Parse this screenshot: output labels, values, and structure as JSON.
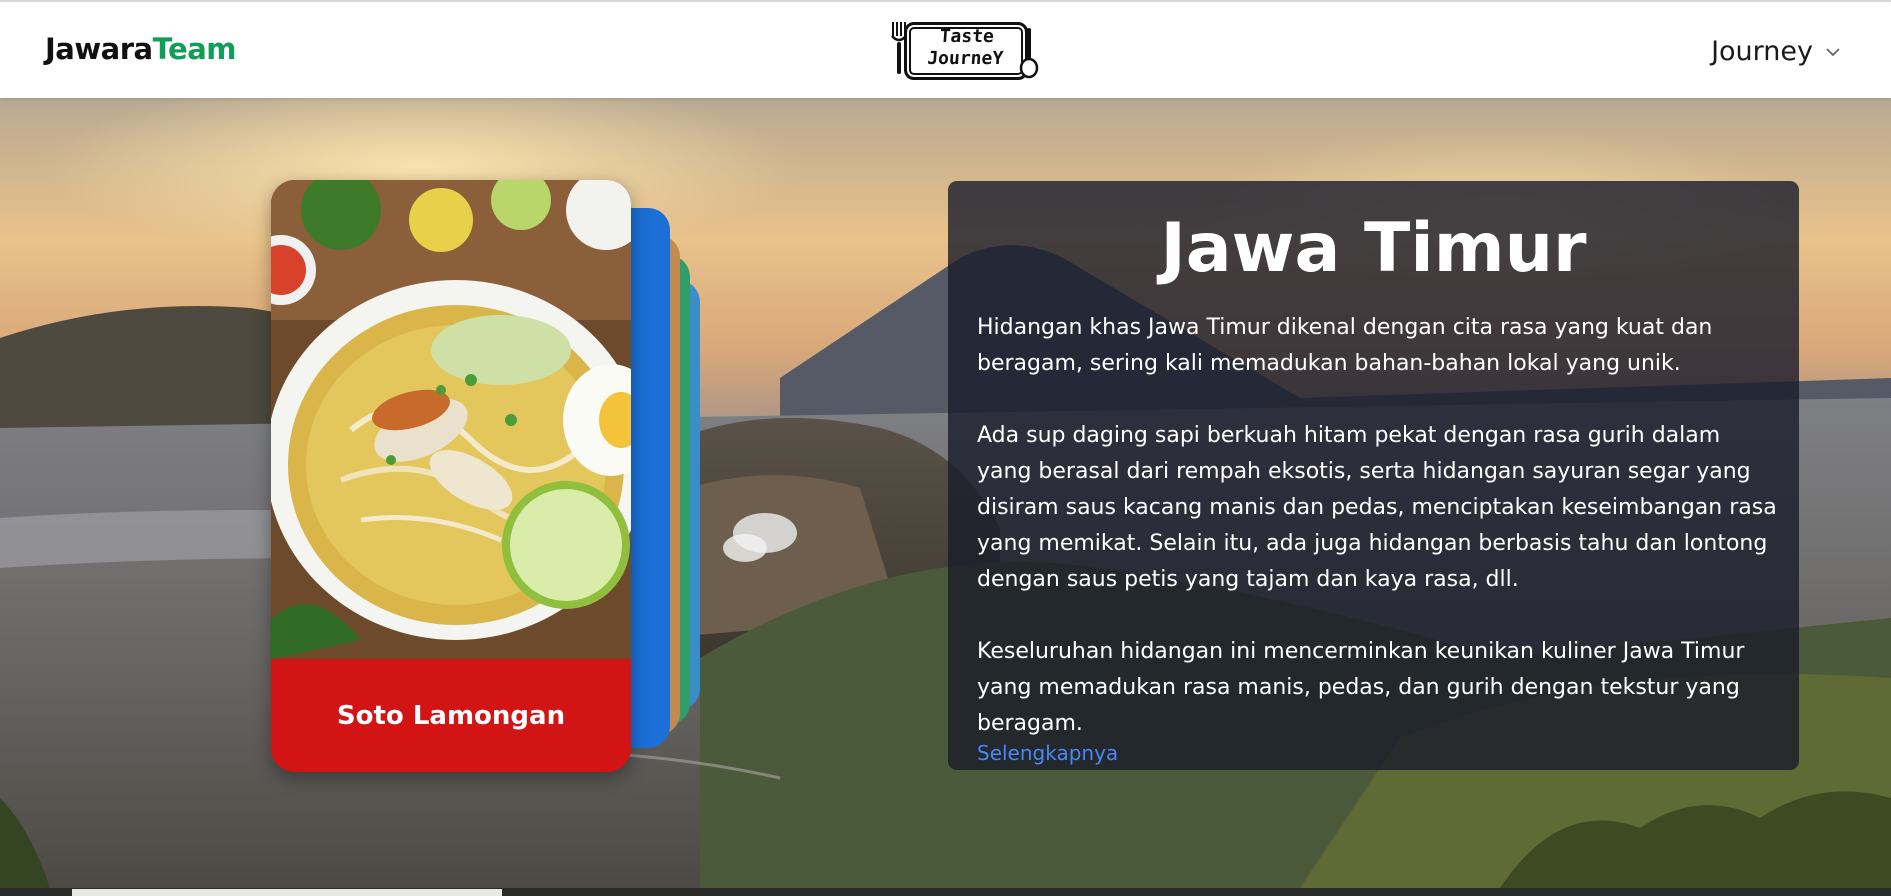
{
  "header": {
    "brand_part1": "Jawara",
    "brand_part2": "Team",
    "logo_line1": "Taste",
    "logo_line2": "JourneY",
    "nav_label": "Journey",
    "nav_icon": "chevron-down-icon"
  },
  "card": {
    "title": "Soto Lamongan",
    "caption_color": "#d21414"
  },
  "info": {
    "title": "Jawa Timur",
    "paragraphs": [
      "Hidangan khas Jawa Timur dikenal dengan cita rasa yang kuat dan beragam, sering kali memadukan bahan-bahan lokal yang unik.",
      "Ada sup daging sapi berkuah hitam pekat dengan rasa gurih dalam yang berasal dari rempah eksotis, serta hidangan sayuran segar yang disiram saus kacang manis dan pedas, menciptakan keseimbangan rasa yang memikat. Selain itu, ada juga hidangan berbasis tahu dan lontong dengan saus petis yang tajam dan kaya rasa, dll.",
      "Keseluruhan hidangan ini mencerminkan keunikan kuliner Jawa Timur yang memadukan rasa manis, pedas, dan gurih dengan tekstur yang beragam."
    ],
    "more_link": "Selengkapnya",
    "link_color": "#4a86f5"
  },
  "colors": {
    "brand_accent": "#0f9d58",
    "panel_bg": "#191b2a"
  }
}
